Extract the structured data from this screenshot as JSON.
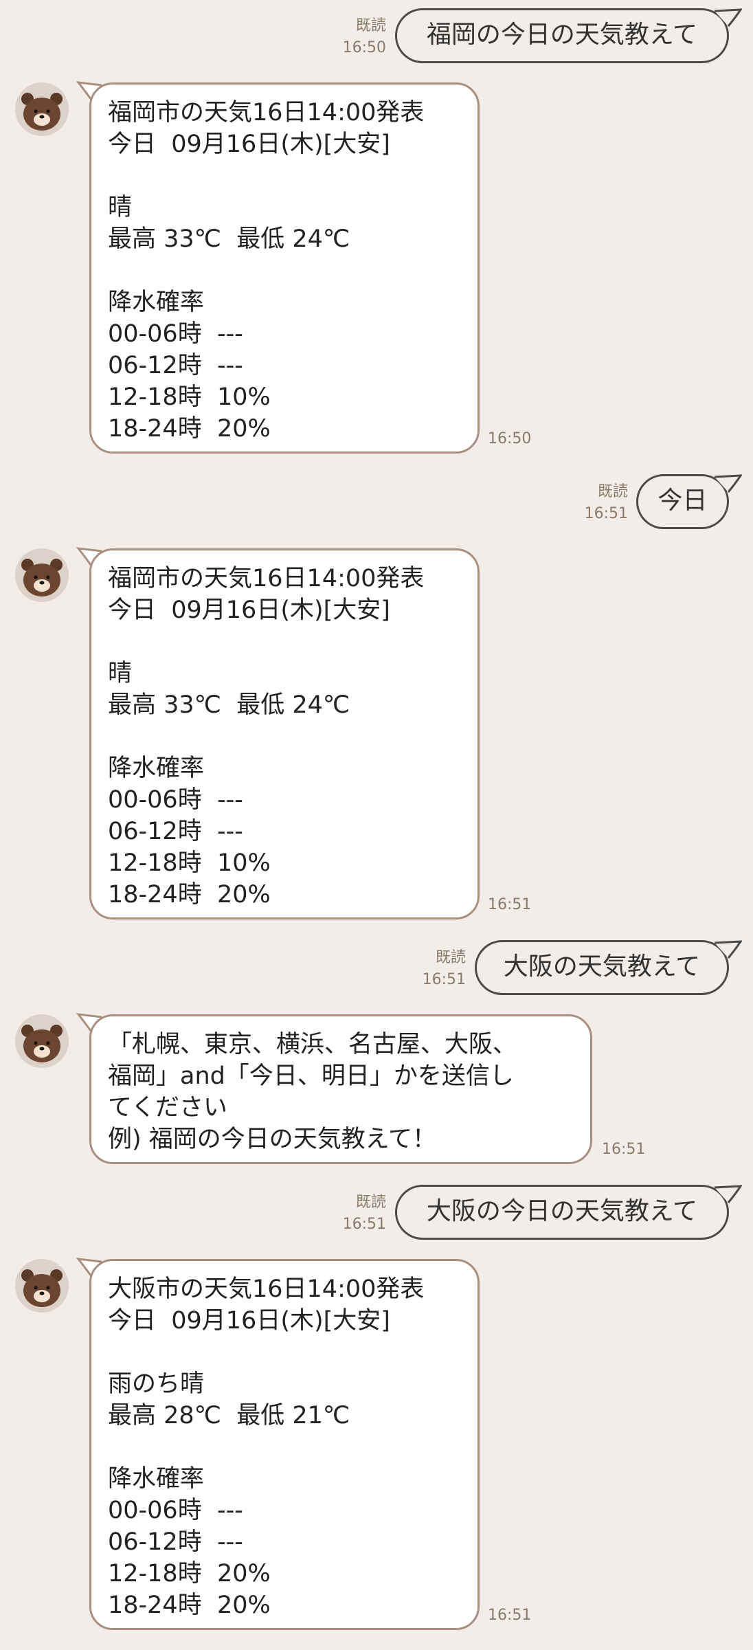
{
  "messages": [
    {
      "side": "out",
      "text": "福岡の今日の天気教えて",
      "read": "既読",
      "time": "16:50"
    },
    {
      "side": "in",
      "text": "福岡市の天気16日14:00発表\n今日  09月16日(木)[大安]\n\n晴\n最高 33℃  最低 24℃\n\n降水確率\n00-06時  ---\n06-12時  ---\n12-18時  10%\n18-24時  20%",
      "time": "16:50"
    },
    {
      "side": "out",
      "text": "今日",
      "read": "既読",
      "time": "16:51"
    },
    {
      "side": "in",
      "text": "福岡市の天気16日14:00発表\n今日  09月16日(木)[大安]\n\n晴\n最高 33℃  最低 24℃\n\n降水確率\n00-06時  ---\n06-12時  ---\n12-18時  10%\n18-24時  20%",
      "time": "16:51"
    },
    {
      "side": "out",
      "text": "大阪の天気教えて",
      "read": "既読",
      "time": "16:51"
    },
    {
      "side": "in",
      "text": "「札幌、東京、横浜、名古屋、大阪、\n福岡」and「今日、明日」かを送信し\nてください\n例) 福岡の今日の天気教えて！",
      "time": "16:51"
    },
    {
      "side": "out",
      "text": "大阪の今日の天気教えて",
      "read": "既読",
      "time": "16:51"
    },
    {
      "side": "in",
      "text": "大阪市の天気16日14:00発表\n今日  09月16日(木)[大安]\n\n雨のち晴\n最高 28℃  最低 21℃\n\n降水確率\n00-06時  ---\n06-12時  ---\n12-18時  20%\n18-24時  20%",
      "time": "16:51"
    }
  ]
}
